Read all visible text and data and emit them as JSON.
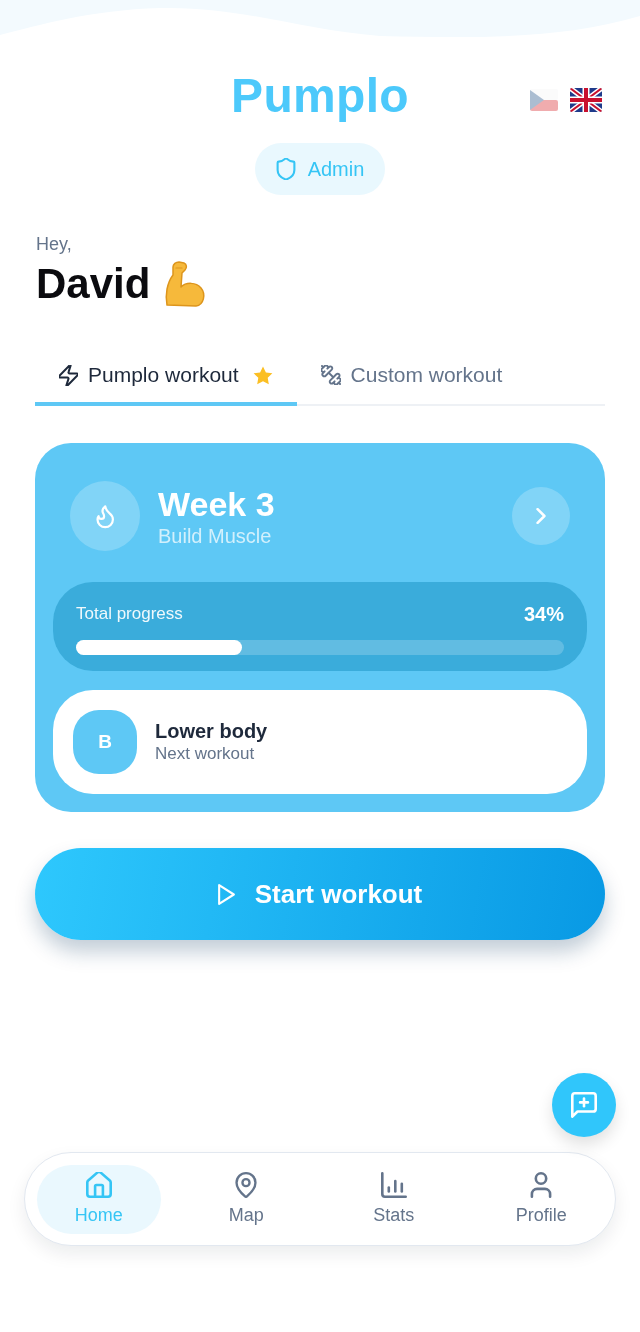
{
  "header": {
    "logo": "Pumplo",
    "role_badge": "Admin",
    "languages": [
      {
        "kind": "czech",
        "selected": false
      },
      {
        "kind": "british",
        "selected": true
      }
    ]
  },
  "greeting": {
    "salutation": "Hey,",
    "name": "David"
  },
  "tabs": [
    {
      "label": "Pumplo workout",
      "kind": "pumplo",
      "selected": true,
      "starred": true
    },
    {
      "label": "Custom workout",
      "kind": "custom",
      "selected": false,
      "starred": false
    }
  ],
  "program_card": {
    "title": "Week 3",
    "subtitle": "Build Muscle",
    "progress": {
      "label": "Total progress",
      "reading": "34%",
      "level": 0.34
    },
    "next_workout": {
      "badge": "B",
      "name": "Lower body",
      "caption": "Next workout"
    }
  },
  "start_button": {
    "label": "Start workout"
  },
  "nav": [
    {
      "label": "Home",
      "kind": "home",
      "selected": true
    },
    {
      "label": "Map",
      "kind": "map",
      "selected": false
    },
    {
      "label": "Stats",
      "kind": "stats",
      "selected": false
    },
    {
      "label": "Profile",
      "kind": "profile",
      "selected": false
    }
  ]
}
